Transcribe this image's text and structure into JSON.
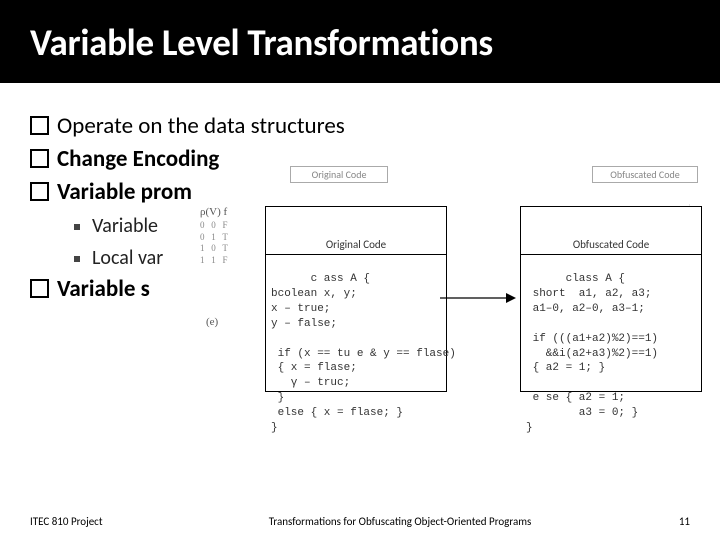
{
  "title": "Variable Level Transformations",
  "bullets": {
    "b1": "Operate on the data structures",
    "b2": "Change Encoding",
    "b3": "Variable prom",
    "sub1": "Variable ",
    "sub2": "Local var",
    "b4": "Variable s"
  },
  "figure": {
    "ghost_left_header": "Original Code",
    "ghost_right_header": "Obfuscated Code",
    "orig_header": "Original Code",
    "obf_header": "Obfuscated Code",
    "orig_code": "c ass A {\nbcolean x, y;\nx – true;\ny – false;\n\n if (x == tu e & y == flase)\n { x = flase;\n   γ – truc;\n }\n else { x = flase; }\n}",
    "obf_code": "class A {\n short  a1, a2, a3;\n a1–0, a2–0, a3–1;\n\n if (((a1+a2)%2)==1)\n   &&i(a2+a3)%2)==1)\n { a2 = 1; }\n\n e se { a2 = 1;\n        a3 = 0; }\n}",
    "rho_label": "ρ(V)   f",
    "table_rows": "0   0   F\n0   1   T\n1   0   T\n1   1   F",
    "e_label": "(e)",
    "ghost_right_lines": "·\n·\n·"
  },
  "footer": {
    "left": "ITEC 810 Project",
    "center": "Transformations for Obfuscating Object-Oriented Programs",
    "page": "11"
  }
}
